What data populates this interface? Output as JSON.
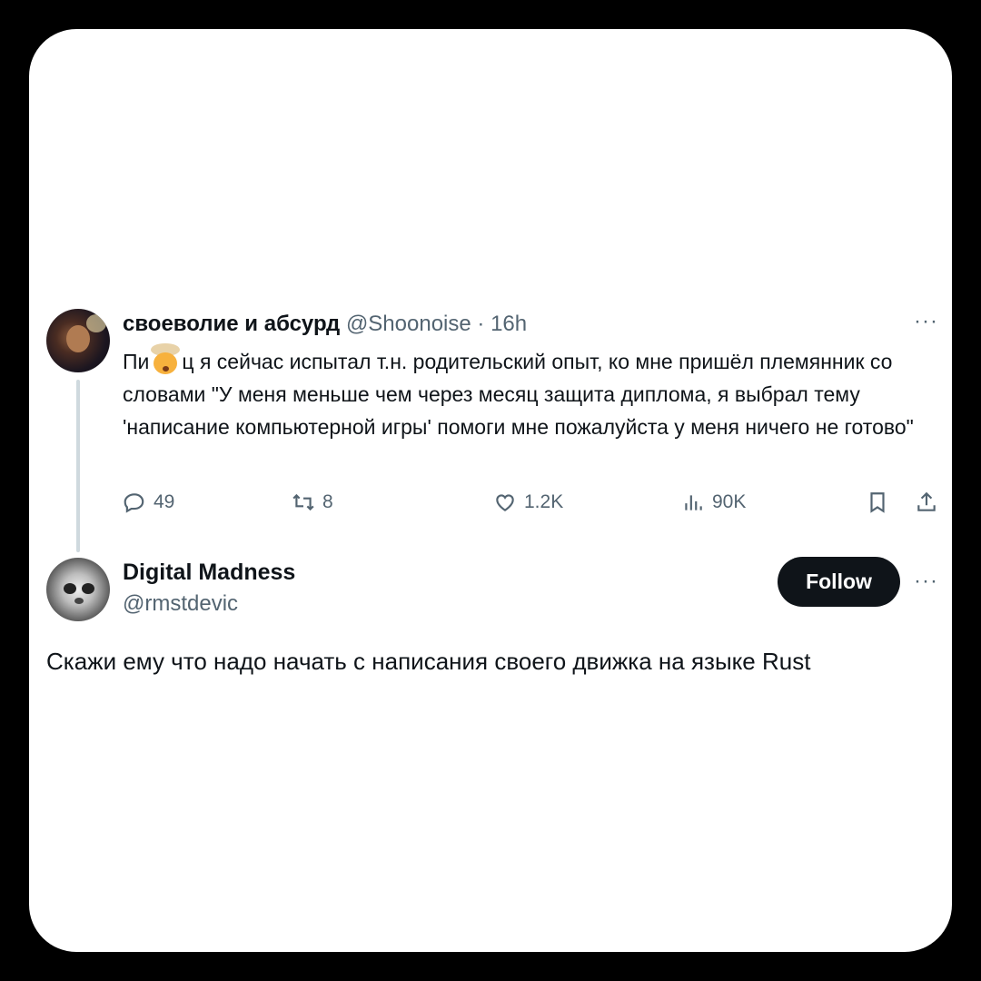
{
  "tweet1": {
    "author_name": "своеволие и абсурд",
    "handle": "@Shoonoise",
    "separator": "·",
    "time": "16h",
    "more": "···",
    "text_before_emoji": "Пи",
    "emoji": "exploding-head-emoji",
    "text_after_emoji": "ц я сейчас испытал т.н. родительский опыт, ко мне пришёл племянник со словами \"У меня меньше чем через месяц защита диплома, я выбрал тему 'написание компьютерной игры' помоги мне пожалуйста у меня ничего не готово\"",
    "actions": {
      "replies": "49",
      "retweets": "8",
      "likes": "1.2K",
      "views": "90K"
    }
  },
  "tweet2": {
    "author_name": "Digital Madness",
    "handle": "@rmstdevic",
    "follow_label": "Follow",
    "more": "···",
    "text": "Скажи ему что надо начать с написания своего движка на языке Rust"
  }
}
